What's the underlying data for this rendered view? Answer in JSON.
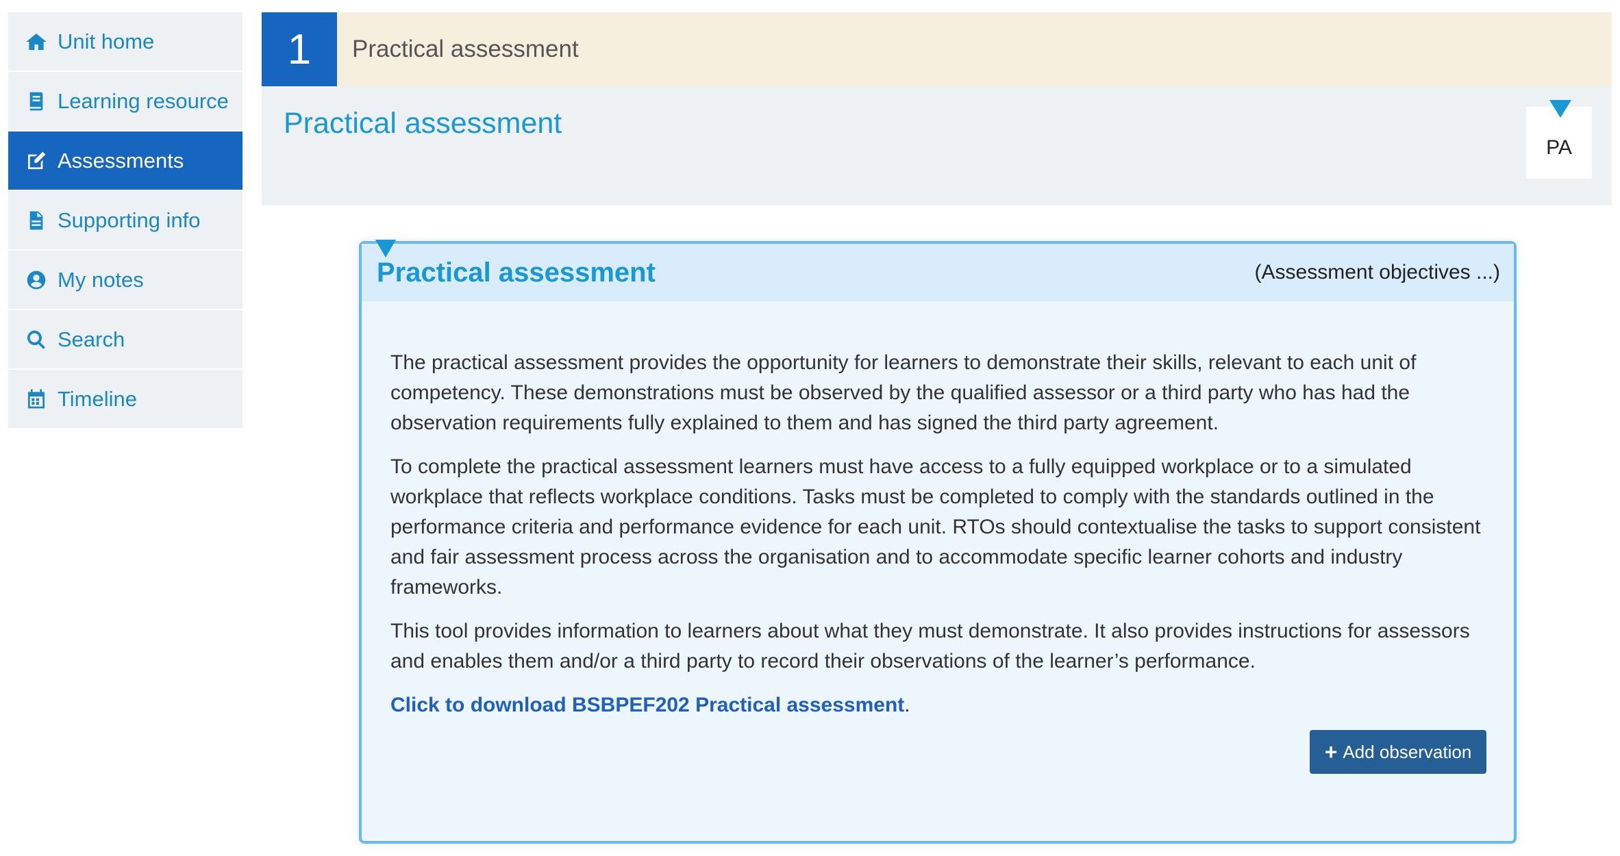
{
  "sidebar": {
    "items": [
      {
        "label": "Unit home",
        "icon": "home-icon",
        "active": false
      },
      {
        "label": "Learning resource",
        "icon": "book-icon",
        "active": false
      },
      {
        "label": "Assessments",
        "icon": "edit-icon",
        "active": true
      },
      {
        "label": "Supporting info",
        "icon": "document-icon",
        "active": false
      },
      {
        "label": "My notes",
        "icon": "user-circle-icon",
        "active": false
      },
      {
        "label": "Search",
        "icon": "search-icon",
        "active": false
      },
      {
        "label": "Timeline",
        "icon": "calendar-icon",
        "active": false
      }
    ]
  },
  "section": {
    "number": "1",
    "title": "Practical assessment"
  },
  "page": {
    "heading": "Practical assessment",
    "badge": "PA"
  },
  "card": {
    "title": "Practical assessment",
    "objectives_link": "(Assessment objectives ...)",
    "paragraphs": [
      "The practical assessment provides the opportunity for learners to demonstrate their skills, relevant to each unit of competency. These demonstrations must be observed by the qualified assessor or a third party who has had the observation requirements fully explained to them and has signed the third party agreement.",
      "To complete the practical assessment learners must have access to a fully equipped workplace or to a simulated workplace that reflects workplace conditions. Tasks must be completed to comply with the standards outlined in the performance criteria and performance evidence for each unit. RTOs should contextualise the tasks to support consistent and fair assessment process across the organisation and to accommodate specific learner cohorts and industry frameworks.",
      "This tool provides information to learners about what they must demonstrate. It also provides instructions for assessors and enables them and/or a third party to record their observations of the learner’s performance."
    ],
    "download_link": "Click to download BSBPEF202 Practical assessment",
    "download_suffix": ".",
    "add_button": "Add observation"
  },
  "colors": {
    "primary": "#1666c0",
    "accent": "#1a98d5",
    "link": "#1f5fbf",
    "button": "#255f96",
    "section_bg": "#f7efdd",
    "card_border": "#6cb8e8"
  }
}
